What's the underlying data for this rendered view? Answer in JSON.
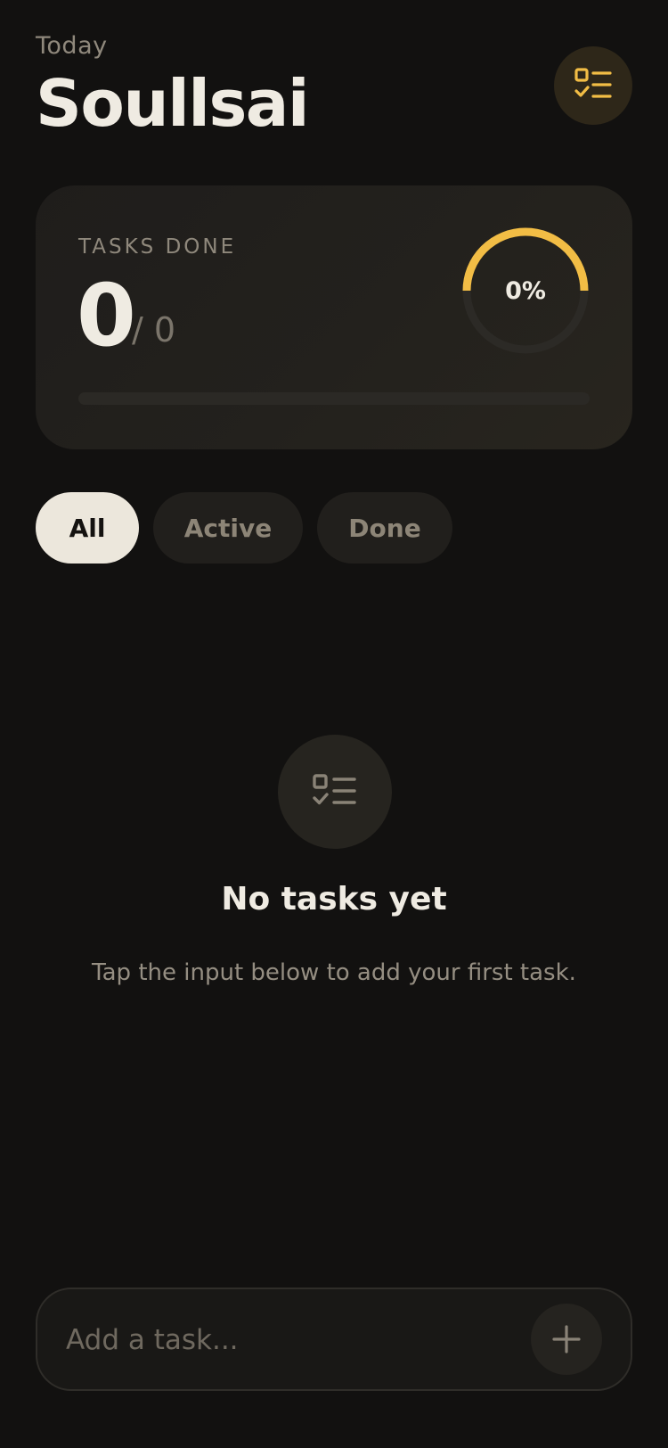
{
  "header": {
    "eyebrow": "Today",
    "title": "Soullsai",
    "icon": "checklist-icon"
  },
  "stats": {
    "label": "TASKS DONE",
    "done": "0",
    "total": "/ 0",
    "percent_label": "0%",
    "progress_fraction": 0
  },
  "filters": {
    "all": "All",
    "active": "Active",
    "done": "Done",
    "selected": "all"
  },
  "empty_state": {
    "icon": "checklist-icon",
    "title": "No tasks yet",
    "subtitle": "Tap the input below to add your first task."
  },
  "composer": {
    "placeholder": "Add a task...",
    "value": "",
    "add_icon": "plus-icon"
  },
  "colors": {
    "background": "#121110",
    "accent": "#f2bd45",
    "text": "#efebe2",
    "muted": "#8f887c"
  }
}
